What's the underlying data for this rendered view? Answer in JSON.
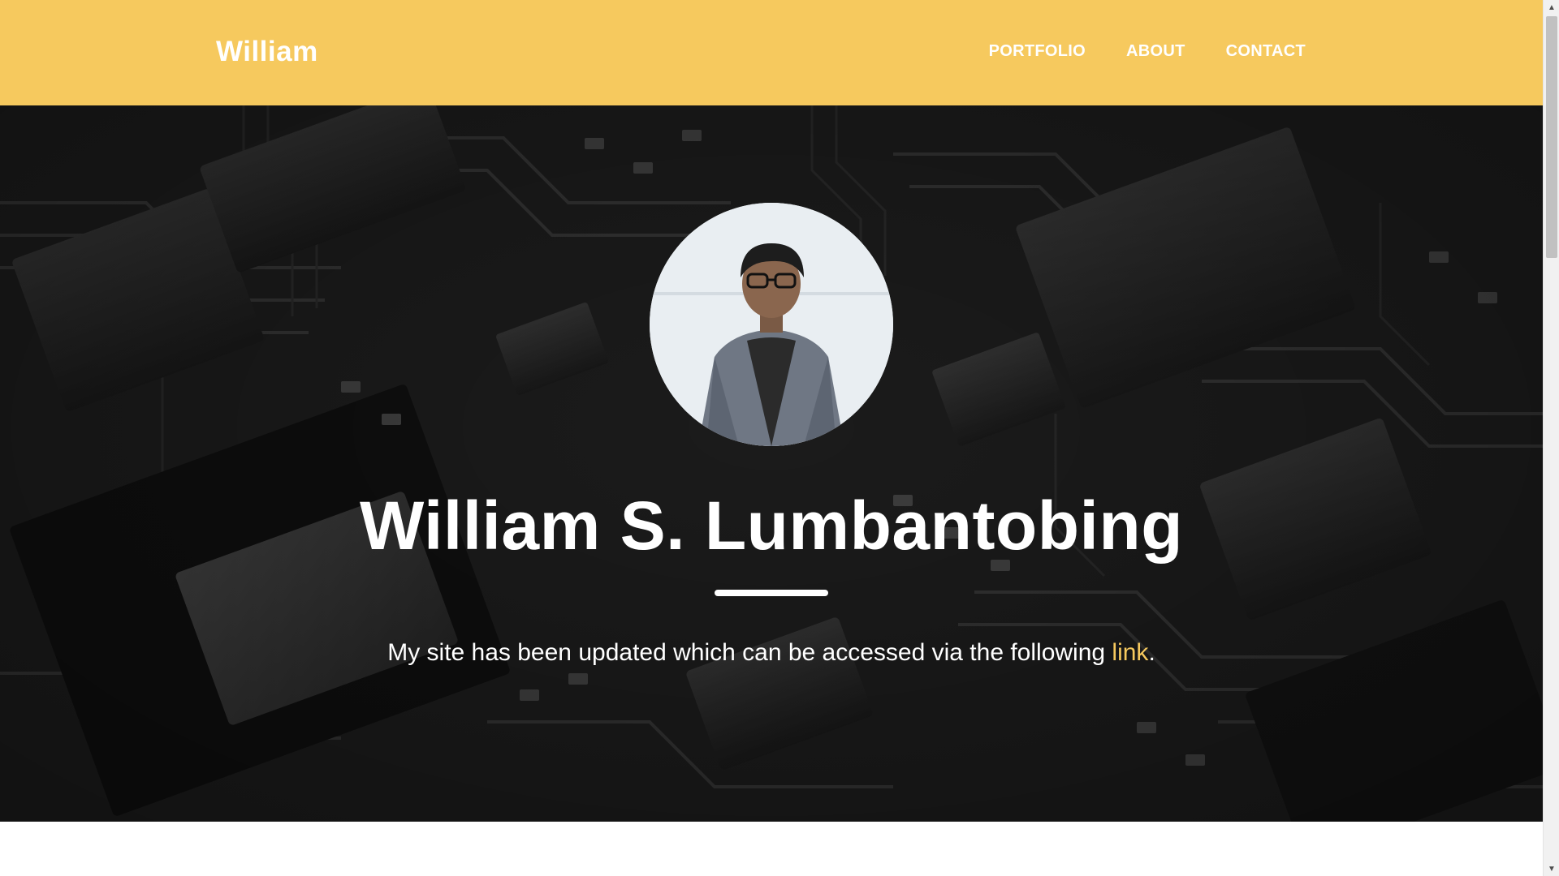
{
  "navbar": {
    "brand": "William",
    "links": [
      "PORTFOLIO",
      "ABOUT",
      "CONTACT"
    ],
    "background_color": "#f6c95e"
  },
  "hero": {
    "title": "William S. Lumbantobing",
    "text_before_link": "My site has been updated which can be accessed via the following ",
    "link_text": "link",
    "text_after_link": ".",
    "link_color": "#f6c95e",
    "avatar_icon": "profile-photo"
  },
  "scrollbar": {
    "up_icon": "arrow-up-icon",
    "down_icon": "arrow-down-icon"
  }
}
